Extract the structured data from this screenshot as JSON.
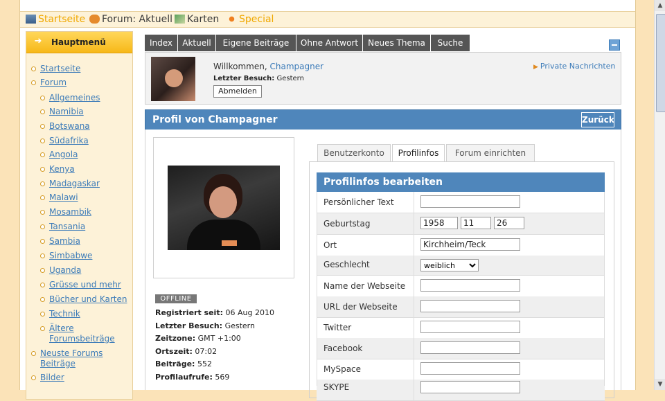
{
  "topnav": {
    "items": [
      {
        "label": "Startseite",
        "icon": "home-icon"
      },
      {
        "label": "Forum: Aktuell",
        "icon": "chat-bubbles-icon"
      },
      {
        "label": "Karten",
        "icon": "map-icon"
      },
      {
        "label": "Special",
        "icon": "sun-icon"
      }
    ]
  },
  "sidebar": {
    "title": "Hauptmenü",
    "items": [
      {
        "label": "Startseite",
        "level": 0
      },
      {
        "label": "Forum",
        "level": 0
      },
      {
        "label": "Allgemeines",
        "level": 1
      },
      {
        "label": "Namibia",
        "level": 1
      },
      {
        "label": "Botswana",
        "level": 1
      },
      {
        "label": "Südafrika",
        "level": 1
      },
      {
        "label": "Angola",
        "level": 1
      },
      {
        "label": "Kenya",
        "level": 1
      },
      {
        "label": "Madagaskar",
        "level": 1
      },
      {
        "label": "Malawi",
        "level": 1
      },
      {
        "label": "Mosambik",
        "level": 1
      },
      {
        "label": "Tansania",
        "level": 1
      },
      {
        "label": "Sambia",
        "level": 1
      },
      {
        "label": "Simbabwe",
        "level": 1
      },
      {
        "label": "Uganda",
        "level": 1
      },
      {
        "label": "Grüsse und mehr",
        "level": 1
      },
      {
        "label": "Bücher und Karten",
        "level": 1
      },
      {
        "label": "Technik",
        "level": 1
      },
      {
        "label": "Ältere Forumsbeiträge",
        "level": 1
      },
      {
        "label": "Neuste Forums Beiträge",
        "level": 0
      },
      {
        "label": "Bilder",
        "level": 0
      }
    ]
  },
  "forum_tabs": [
    "Index",
    "Aktuell",
    "Eigene Beiträge",
    "Ohne Antwort",
    "Neues Thema",
    "Suche"
  ],
  "welcome": {
    "greeting": "Willkommen,",
    "username": "Champagner",
    "last_visit_label": "Letzter Besuch:",
    "last_visit_value": "Gestern",
    "logout_label": "Abmelden",
    "pm_label": "Private Nachrichten"
  },
  "profile": {
    "title": "Profil von Champagner",
    "back_label": "Zurück",
    "status": "OFFLINE",
    "info": [
      {
        "label": "Registriert seit:",
        "value": "06 Aug 2010"
      },
      {
        "label": "Letzter Besuch:",
        "value": "Gestern"
      },
      {
        "label": "Zeitzone:",
        "value": "GMT +1:00"
      },
      {
        "label": "Ortszeit:",
        "value": "07:02"
      },
      {
        "label": "Beiträge:",
        "value": "552"
      },
      {
        "label": "Profilaufrufe:",
        "value": "569"
      }
    ]
  },
  "profile_tabs": {
    "items": [
      "Benutzerkonto",
      "Profilinfos",
      "Forum einrichten"
    ],
    "active": "Profilinfos"
  },
  "form": {
    "title": "Profilinfos bearbeiten",
    "fields": [
      {
        "label": "Persönlicher Text",
        "value": ""
      },
      {
        "label": "Geburtstag",
        "year": "1958",
        "month": "11",
        "day": "26"
      },
      {
        "label": "Ort",
        "value": "Kirchheim/Teck"
      },
      {
        "label": "Geschlecht",
        "selected": "weiblich"
      },
      {
        "label": "Name der Webseite",
        "value": ""
      },
      {
        "label": "URL der Webseite",
        "value": ""
      },
      {
        "label": "Twitter",
        "value": ""
      },
      {
        "label": "Facebook",
        "value": ""
      },
      {
        "label": "MySpace",
        "value": ""
      },
      {
        "label": "SKYPE",
        "value": ""
      }
    ]
  },
  "colors": {
    "header_blue": "#4f86bb",
    "tab_gray": "#555555",
    "page_bg": "#fbe3b8",
    "sidebar_bg": "#fdf2d8",
    "link": "#3a7ab8",
    "accent_gold": "#f7b818"
  }
}
